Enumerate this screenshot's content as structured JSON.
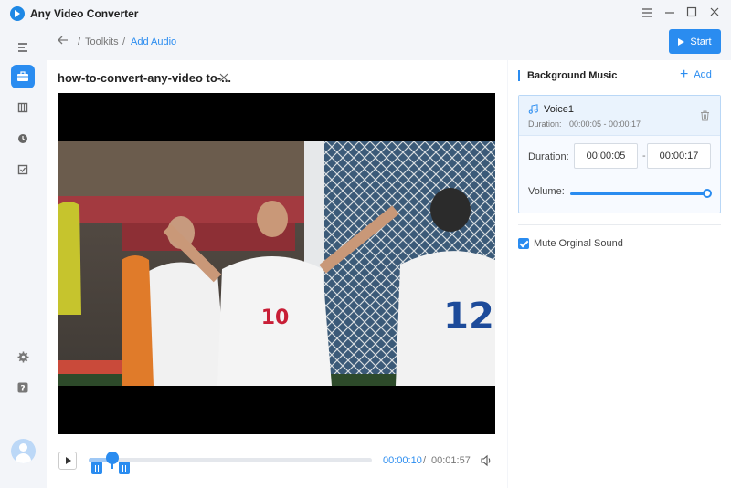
{
  "app": {
    "title": "Any Video Converter"
  },
  "breadcrumb": {
    "root": "Toolkits",
    "separator": "/",
    "current": "Add Audio"
  },
  "toolbar": {
    "start_label": "Start"
  },
  "editor": {
    "file_title": "how-to-convert-any-video to-...",
    "time_current": "00:00:10",
    "time_separator": "/",
    "time_total": "00:01:57",
    "progress_fraction": 0.085
  },
  "background_music": {
    "title": "Background Music",
    "add_label": "Add",
    "track": {
      "name": "Voice1",
      "duration_label": "Duration:",
      "duration_value": "00:00:05 - 00:00:17",
      "duration_field_label": "Duration:",
      "start": "00:00:05",
      "range_separator": "-",
      "end": "00:00:17",
      "volume_label": "Volume:",
      "volume_fraction": 1.0
    },
    "mute_original_label": "Mute Orginal Sound",
    "mute_original_checked": true
  },
  "colors": {
    "accent": "#2a8cf0",
    "background": "#f3f5f9",
    "panel": "#ffffff"
  },
  "icons": {
    "sidebar": [
      "toolbox-icon",
      "film-icon",
      "history-icon",
      "checklist-icon"
    ],
    "sidebar_bottom": [
      "gear-icon",
      "help-icon",
      "avatar"
    ]
  }
}
